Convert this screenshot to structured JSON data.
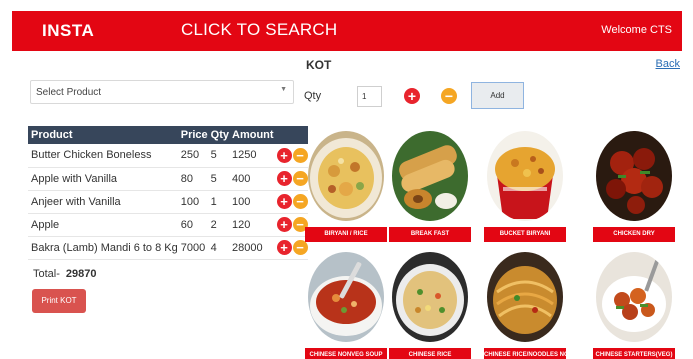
{
  "header": {
    "brand": "INSTA",
    "search": "CLICK TO SEARCH",
    "welcome": "Welcome CTS",
    "color": "#e30613"
  },
  "product_select": {
    "value": "Select Product"
  },
  "order_table": {
    "headers": [
      "Product",
      "Price",
      "Qty",
      "Amount"
    ],
    "rows": [
      {
        "product": "Butter Chicken Boneless",
        "price": "250",
        "qty": "5",
        "amount": "1250"
      },
      {
        "product": "Apple with Vanilla",
        "price": "80",
        "qty": "5",
        "amount": "400"
      },
      {
        "product": "Anjeer with Vanilla",
        "price": "100",
        "qty": "1",
        "amount": "100"
      },
      {
        "product": "Apple",
        "price": "60",
        "qty": "2",
        "amount": "120"
      },
      {
        "product": "Bakra (Lamb) Mandi 6 to 8 Kg",
        "price": "7000",
        "qty": "4",
        "amount": "28000"
      }
    ],
    "plus_icon": "plus-circle-icon",
    "minus_icon": "minus-circle-icon"
  },
  "total": {
    "label": "Total-",
    "value": "29870"
  },
  "print_button": "Print KOT",
  "kot": {
    "title": "KOT",
    "back": "Back",
    "qty_label": "Qty",
    "qty_value": "1",
    "add_label": "Add"
  },
  "categories": [
    {
      "name": "BIRYANI / RICE",
      "image": "biryani-rice-image"
    },
    {
      "name": "BREAK FAST",
      "image": "breakfast-dosa-image"
    },
    {
      "name": "BUCKET BIRYANI",
      "image": "bucket-biryani-image"
    },
    {
      "name": "CHICKEN DRY",
      "image": "chicken-dry-image"
    },
    {
      "name": "CHINESE NONVEG SOUP",
      "image": "nonveg-soup-image"
    },
    {
      "name": "CHINESE RICE",
      "image": "chinese-rice-image"
    },
    {
      "name": "CHINESE RICE/NOODLES NON VEG",
      "image": "noodles-image"
    },
    {
      "name": "CHINESE STARTERS(VEG)",
      "image": "veg-starters-image"
    }
  ],
  "colors": {
    "accent": "#e30613",
    "table_header": "#37465b",
    "plus": "#e8242d",
    "minus": "#f5a623",
    "print_button": "#d9534f",
    "link": "#2a6db5"
  }
}
